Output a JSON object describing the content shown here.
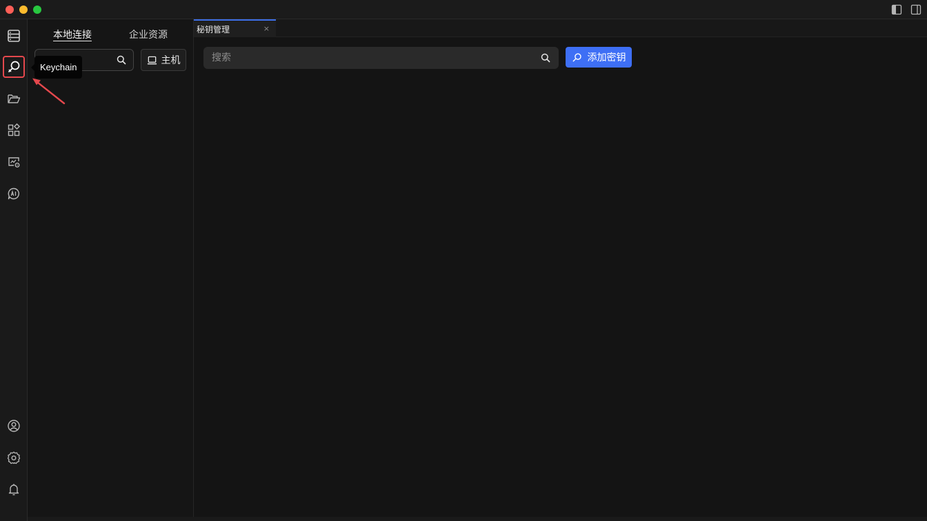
{
  "sidebar": {
    "tabs": [
      {
        "label": "本地连接"
      },
      {
        "label": "企业资源"
      }
    ],
    "host_button": "主机"
  },
  "tooltip": "Keychain",
  "tabs": [
    {
      "label": "秘钥管理",
      "close": "×"
    }
  ],
  "main": {
    "search_placeholder": "搜索",
    "add_button": "添加密钥"
  },
  "activity_icons": [
    "server-icon",
    "keychain-icon",
    "folder-icon",
    "apps-icon",
    "monitor-icon",
    "ai-icon",
    "user-icon",
    "settings-icon",
    "bell-icon"
  ],
  "colors": {
    "accent": "#3e6ff5",
    "highlight": "#e5484d",
    "background": "#141414"
  }
}
